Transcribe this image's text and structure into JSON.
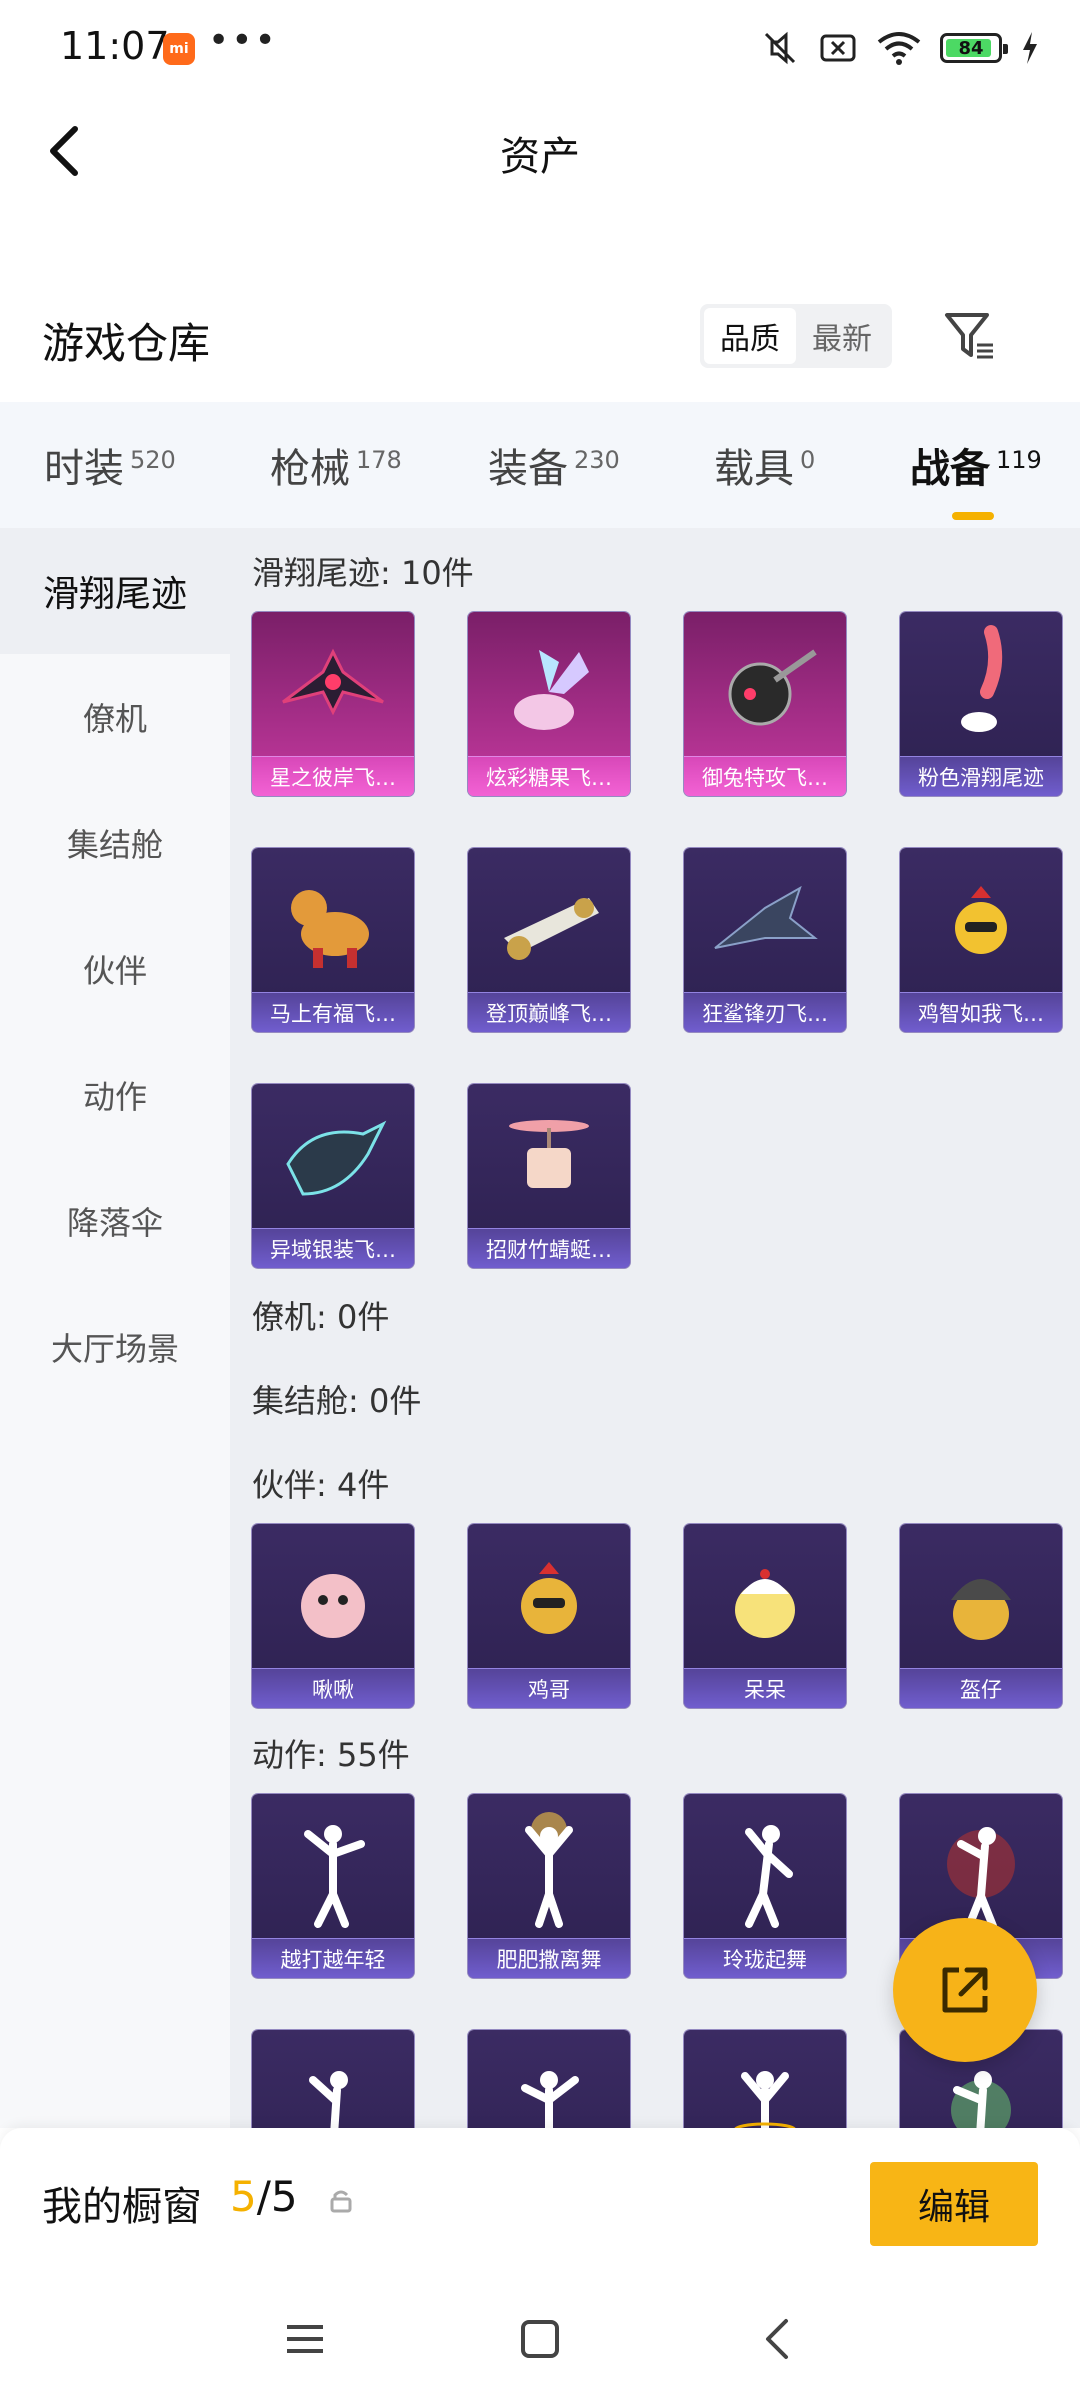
{
  "status_bar": {
    "time": "11:07",
    "mi_badge": "mi",
    "dots": "•••",
    "battery": "84"
  },
  "header": {
    "title": "资产"
  },
  "warehouse": {
    "title": "游戏仓库",
    "sort_options": [
      "品质",
      "最新"
    ],
    "sort_active": "品质"
  },
  "categories": [
    {
      "label": "时装",
      "count": "520"
    },
    {
      "label": "枪械",
      "count": "178"
    },
    {
      "label": "装备",
      "count": "230"
    },
    {
      "label": "载具",
      "count": "0"
    },
    {
      "label": "战备",
      "count": "119"
    }
  ],
  "sidebar": [
    "滑翔尾迹",
    "僚机",
    "集结舱",
    "伙伴",
    "动作",
    "降落伞",
    "大厅场景"
  ],
  "sections": {
    "glide": {
      "title": "滑翔尾迹: 10件",
      "items": [
        "星之彼岸飞…",
        "炫彩糖果飞…",
        "御兔特攻飞…",
        "粉色滑翔尾迹",
        "马上有福飞…",
        "登顶巅峰飞…",
        "狂鲨锋刃飞…",
        "鸡智如我飞…",
        "异域银装飞…",
        "招财竹蜻蜓…"
      ]
    },
    "wingman": {
      "title": "僚机: 0件"
    },
    "pod": {
      "title": "集结舱: 0件"
    },
    "partner": {
      "title": "伙伴: 4件",
      "items": [
        "啾啾",
        "鸡哥",
        "呆呆",
        "盔仔"
      ]
    },
    "action": {
      "title": "动作: 55件",
      "items": [
        "越打越年轻",
        "肥肥撒离舞",
        "玲珑起舞",
        ""
      ]
    }
  },
  "showcase": {
    "label": "我的橱窗",
    "count_current": "5",
    "count_sep_total": "/5",
    "edit_label": "编辑"
  },
  "colors": {
    "accent": "#f5b100",
    "tile_purple": "#2d2150",
    "tile_pink": "#c5399f"
  }
}
